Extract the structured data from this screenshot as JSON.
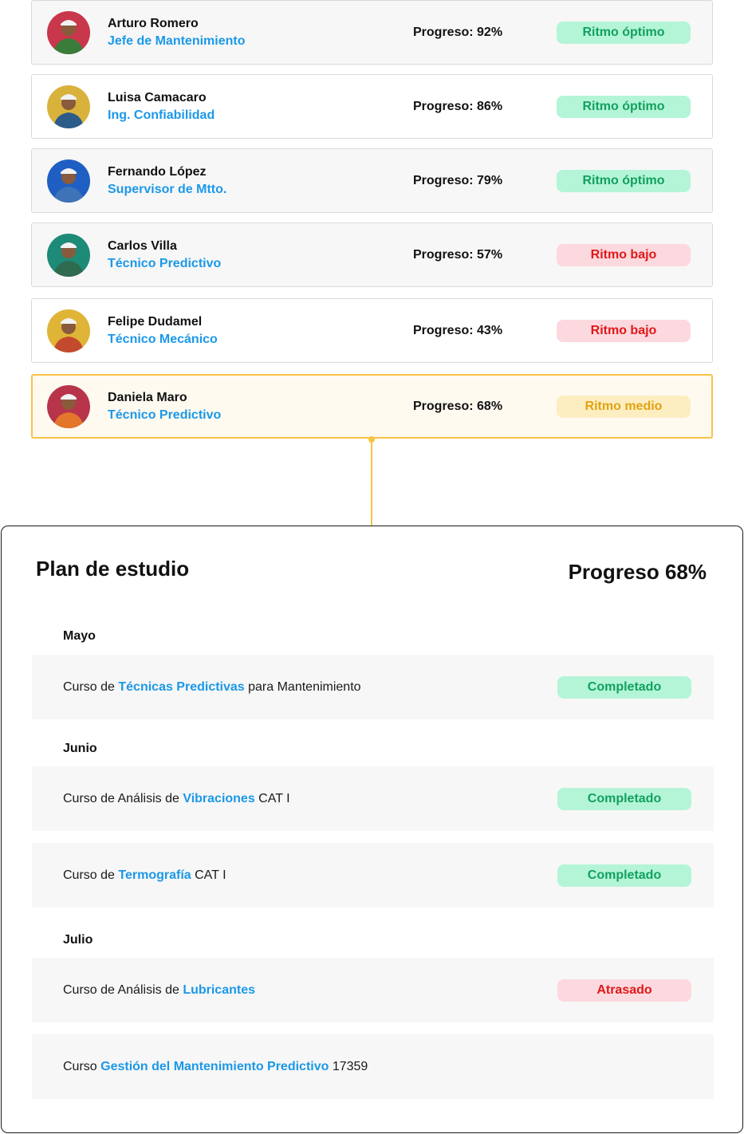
{
  "people": [
    {
      "name": "Arturo Romero",
      "role": "Jefe de Mantenimiento",
      "progress": "Progreso: 92%",
      "status": "Ritmo óptimo",
      "status_kind": "ok",
      "avatar_bg": "#c8374b",
      "shirt": "#3a7d3a"
    },
    {
      "name": "Luisa Camacaro",
      "role": "Ing. Confiabilidad",
      "progress": "Progreso: 86%",
      "status": "Ritmo óptimo",
      "status_kind": "ok",
      "avatar_bg": "#d8b23a",
      "shirt": "#2b5c8a"
    },
    {
      "name": "Fernando López",
      "role": "Supervisor de Mtto.",
      "progress": "Progreso: 79%",
      "status": "Ritmo óptimo",
      "status_kind": "ok",
      "avatar_bg": "#1f5fc4",
      "shirt": "#3e73b8"
    },
    {
      "name": "Carlos Villa",
      "role": "Técnico Predictivo",
      "progress": "Progreso: 57%",
      "status": "Ritmo bajo",
      "status_kind": "bad",
      "avatar_bg": "#1e8a78",
      "shirt": "#2e6b4f"
    },
    {
      "name": "Felipe Dudamel",
      "role": "Técnico Mecánico",
      "progress": "Progreso: 43%",
      "status": "Ritmo bajo",
      "status_kind": "bad",
      "avatar_bg": "#e0b436",
      "shirt": "#c24a2e"
    },
    {
      "name": "Daniela Maro",
      "role": "Técnico Predictivo",
      "progress": "Progreso: 68%",
      "status": "Ritmo medio",
      "status_kind": "mid",
      "avatar_bg": "#b8344a",
      "shirt": "#e3762a"
    }
  ],
  "plan": {
    "title": "Plan de estudio",
    "progress": "Progreso 68%",
    "months": [
      {
        "label": "Mayo"
      },
      {
        "label": "Junio"
      },
      {
        "label": "Julio"
      }
    ],
    "courses": [
      {
        "pre": "Curso de ",
        "highlight": "Técnicas Predictivas",
        "post": " para Mantenimiento",
        "status": "Completado",
        "status_kind": "ok"
      },
      {
        "pre": "Curso de Análisis de ",
        "highlight": "Vibraciones",
        "post": " CAT I",
        "status": "Completado",
        "status_kind": "ok"
      },
      {
        "pre": "Curso de ",
        "highlight": "Termografía",
        "post": " CAT I",
        "status": "Completado",
        "status_kind": "ok"
      },
      {
        "pre": "Curso de Análisis de ",
        "highlight": "Lubricantes",
        "post": "",
        "status": "Atrasado",
        "status_kind": "bad"
      },
      {
        "pre": "Curso ",
        "highlight": "Gestión del Mantenimiento Predictivo",
        "post": " 17359",
        "status": "",
        "status_kind": "none"
      }
    ]
  },
  "colors": {
    "accent": "#1b98e8",
    "selected_border": "#f7c344",
    "ok_bg": "#b4f5d7",
    "ok_text": "#12a060",
    "bad_bg": "#fcd9df",
    "bad_text": "#e01818",
    "mid_bg": "#fdeec2",
    "mid_text": "#e0a412"
  }
}
